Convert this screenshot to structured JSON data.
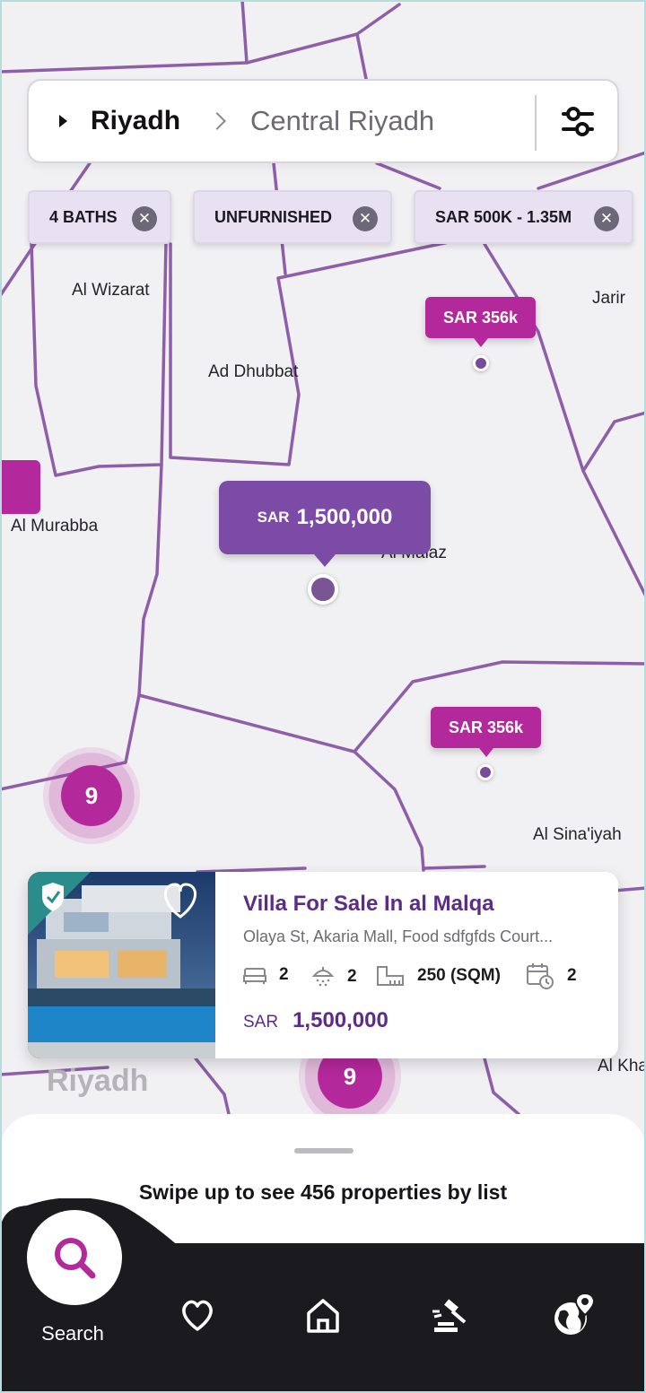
{
  "search": {
    "city": "Riyadh",
    "area": "Central Riyadh"
  },
  "filters": [
    {
      "label": "4 BATHS"
    },
    {
      "label": "UNFURNISHED"
    },
    {
      "label": "SAR 500K - 1.35M"
    }
  ],
  "map_labels": {
    "al_wizarat": "Al Wizarat",
    "jarir": "Jarir",
    "ad_dhubbat": "Ad Dhubbat",
    "al_murabba": "Al Murabba",
    "al_malaz": "Al Malaz",
    "al_sinaiyah": "Al Sina'iyah",
    "al_kha": "Al Kha",
    "riyadh": "Riyadh"
  },
  "pins": {
    "pin1": "SAR 356k",
    "pin2": "SAR 356k",
    "selected_currency": "SAR",
    "selected_price": "1,500,000"
  },
  "clusters": {
    "left_count": "9",
    "bottom_count": "9"
  },
  "card": {
    "title": "Villa For Sale In al Malqa",
    "address": "Olaya St, Akaria Mall, Food sdfgfds Court...",
    "beds": "2",
    "baths": "2",
    "area": "250 (SQM)",
    "years": "2",
    "currency": "SAR",
    "price": "1,500,000"
  },
  "sheet": {
    "text": "Swipe up to see 456 properties by list"
  },
  "nav": {
    "search_label": "Search",
    "active_color": "#b3289a"
  },
  "colors": {
    "brand": "#b3289a",
    "purple": "#7c4ba6",
    "road": "#8e5ea8"
  }
}
